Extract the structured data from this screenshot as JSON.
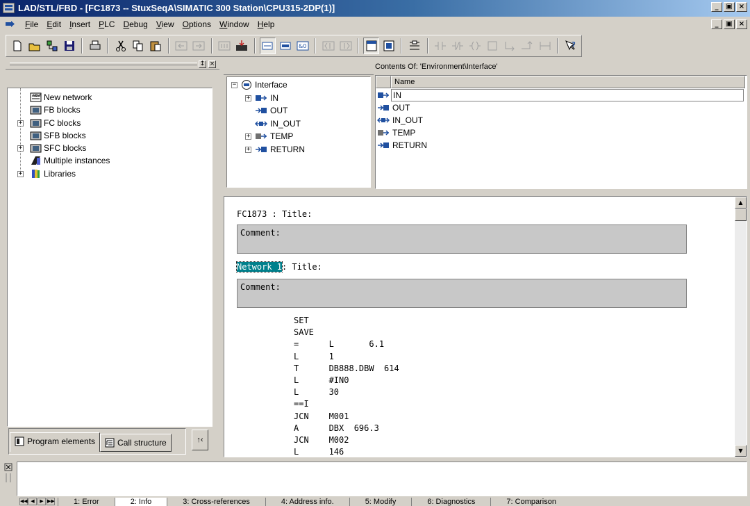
{
  "window": {
    "title": "LAD/STL/FBD  - [FC1873 -- StuxSeqA\\SIMATIC 300 Station\\CPU315-2DP(1)]",
    "min": "_",
    "restore": "̸",
    "close": "×"
  },
  "menu": {
    "items": [
      "File",
      "Edit",
      "Insert",
      "PLC",
      "Debug",
      "View",
      "Options",
      "Window",
      "Help"
    ]
  },
  "toolbar": {
    "buttons": [
      "new-icon",
      "open-icon",
      "accessible-nodes-icon",
      "save-icon",
      "print-icon",
      "cut-icon",
      "copy-icon",
      "paste-icon",
      "undo-icon",
      "redo-icon",
      "load-icon",
      "monitor-icon",
      "overview-icon",
      "comment-icon",
      "address-icon",
      "prev-icon",
      "next-icon",
      "lad-icon",
      "stl-icon",
      "network-icon",
      "no-contact-icon",
      "nc-contact-icon",
      "coil-icon",
      "box-icon",
      "branch-icon",
      "close-branch-icon",
      "open-branch-icon",
      "help-icon"
    ]
  },
  "left_panel": {
    "tree": [
      {
        "label": "New network",
        "expandable": false,
        "icon": "new-network-icon"
      },
      {
        "label": "FB blocks",
        "expandable": false,
        "icon": "fb-blocks-icon"
      },
      {
        "label": "FC blocks",
        "expandable": true,
        "icon": "fc-blocks-icon"
      },
      {
        "label": "SFB blocks",
        "expandable": false,
        "icon": "sfb-blocks-icon"
      },
      {
        "label": "SFC blocks",
        "expandable": true,
        "icon": "sfc-blocks-icon"
      },
      {
        "label": "Multiple instances",
        "expandable": false,
        "icon": "multiple-instances-icon"
      },
      {
        "label": "Libraries",
        "expandable": true,
        "icon": "libraries-icon"
      }
    ],
    "tabs": {
      "program_elements": "Program elements",
      "call_structure": "Call structure"
    },
    "action_button": "↑‹"
  },
  "interface_tree": {
    "root": "Interface",
    "items": [
      {
        "label": "IN",
        "expandable": true
      },
      {
        "label": "OUT",
        "expandable": false
      },
      {
        "label": "IN_OUT",
        "expandable": false
      },
      {
        "label": "TEMP",
        "expandable": true
      },
      {
        "label": "RETURN",
        "expandable": true
      }
    ]
  },
  "contents": {
    "title": "Contents Of: 'Environment\\Interface'",
    "column_name": "Name",
    "rows": [
      "IN",
      "OUT",
      "IN_OUT",
      "TEMP",
      "RETURN"
    ],
    "selected_index": 0
  },
  "code": {
    "block_title": "FC1873 : Title:",
    "comment_label": "Comment:",
    "network_label": "Network 1",
    "network_suffix": ": Title:",
    "network_comment": "Comment:",
    "stl": [
      "SET",
      "SAVE",
      "=      L       6.1",
      "L      1",
      "T      DB888.DBW  614",
      "L      #IN0",
      "L      30",
      "==I",
      "JCN    M001",
      "A      DBX  696.3",
      "JCN    M002",
      "L      146"
    ]
  },
  "output_tabs": {
    "tabs": [
      "1: Error",
      "2: Info",
      "3: Cross-references",
      "4: Address info.",
      "5: Modify",
      "6: Diagnostics",
      "7: Comparison"
    ],
    "active_index": 1
  },
  "colors": {
    "title_start": "#0a246a",
    "title_end": "#a6caf0",
    "face": "#d4d0c8",
    "network_highlight": "#00808c",
    "comment_bg": "#c8c8c8"
  }
}
